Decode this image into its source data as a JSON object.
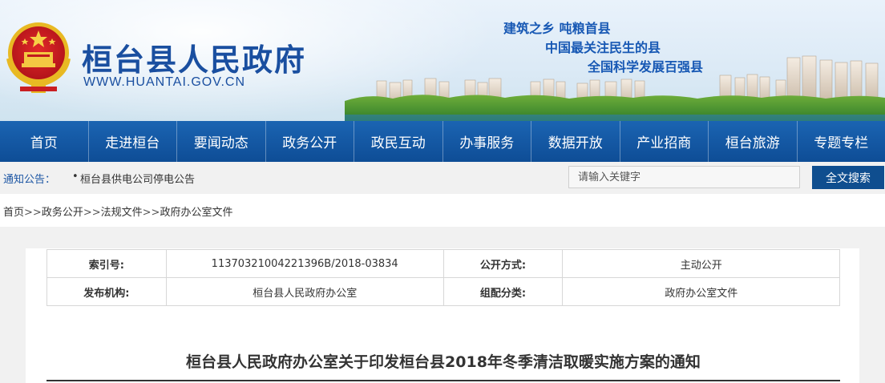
{
  "header": {
    "site_title": "桓台县人民政府",
    "site_domain": "WWW.HUANTAI.GOV.CN",
    "slogans": [
      "建筑之乡 吨粮首县",
      "中国最关注民生的县",
      "全国科学发展百强县"
    ],
    "emblem": "national-emblem-icon",
    "colors": {
      "title": "#1a4fa0",
      "slogan": "#1758b4"
    }
  },
  "nav": {
    "items": [
      "首页",
      "走进桓台",
      "要闻动态",
      "政务公开",
      "政民互动",
      "办事服务",
      "数据开放",
      "产业招商",
      "桓台旅游",
      "专题专栏"
    ],
    "colors": {
      "bar": "#0e4d96",
      "text": "#ffffff"
    }
  },
  "notice": {
    "label": "通知公告：",
    "bullet": "•",
    "items": [
      "桓台县供电公司停电公告"
    ]
  },
  "search": {
    "placeholder": "请输入关键字",
    "button_label": "全文搜索",
    "button_color": "#0f4e8f"
  },
  "breadcrumb": {
    "items": [
      "首页",
      "政务公开",
      "法规文件",
      "政府办公室文件"
    ],
    "separator": ">>"
  },
  "meta": {
    "index_label": "索引号:",
    "index_value": "11370321004221396B/2018-03834",
    "open_label": "公开方式:",
    "open_value": "主动公开",
    "publisher_label": "发布机构:",
    "publisher_value": "桓台县人民政府办公室",
    "category_label": "组配分类:",
    "category_value": "政府办公室文件"
  },
  "document": {
    "title": "桓台县人民政府办公室关于印发桓台县2018年冬季清洁取暖实施方案的通知"
  }
}
